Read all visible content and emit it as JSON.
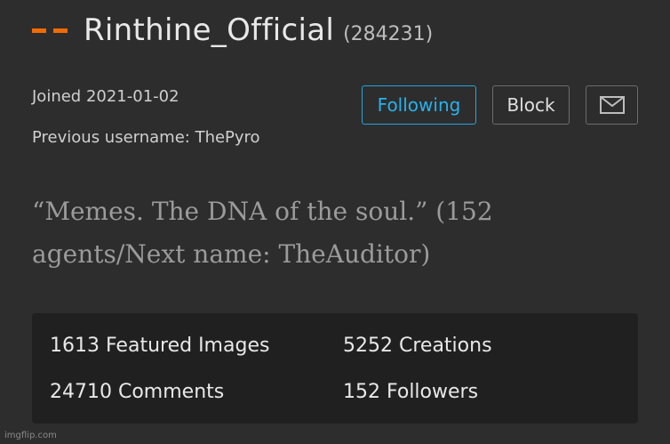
{
  "profile": {
    "username": "Rinthine_Official",
    "points": "(284231)",
    "joined": "Joined 2021-01-02",
    "previous_username": "Previous username: ThePyro",
    "bio": "“Memes. The DNA of the soul.” (152 agents/Next name: TheAuditor)"
  },
  "buttons": {
    "following": "Following",
    "block": "Block",
    "message_icon": "envelope-icon"
  },
  "stats": [
    "1613 Featured Images",
    "5252 Creations",
    "24710 Comments",
    "152 Followers"
  ],
  "watermark": "imgflip.com",
  "colors": {
    "accent_orange": "#f26b00",
    "following_blue": "#26b2ee",
    "background": "#2d2d2d",
    "stats_panel": "#202020"
  }
}
